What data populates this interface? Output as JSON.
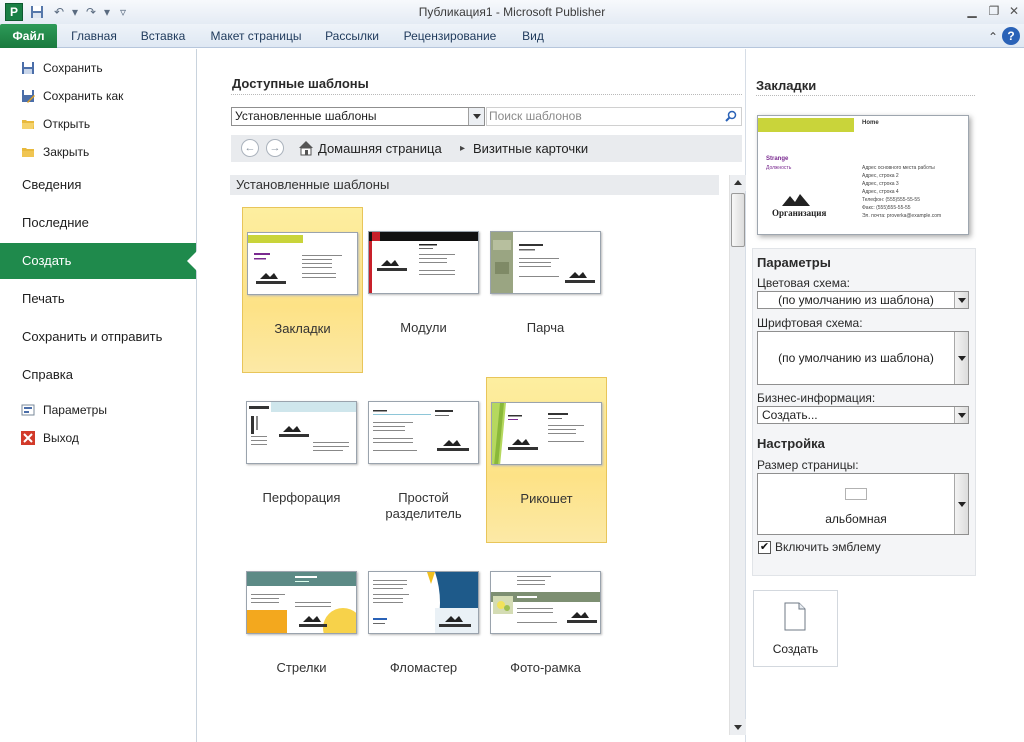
{
  "window": {
    "title": "Публикация1  -  Microsoft Publisher",
    "app_icon": "P"
  },
  "quick_access": {
    "save_icon": "floppy-icon",
    "undo_icon": "undo-icon",
    "redo_icon": "redo-icon"
  },
  "ribbon": {
    "tabs": [
      {
        "label": "Файл"
      },
      {
        "label": "Главная"
      },
      {
        "label": "Вставка"
      },
      {
        "label": "Макет страницы"
      },
      {
        "label": "Рассылки"
      },
      {
        "label": "Рецензирование"
      },
      {
        "label": "Вид"
      }
    ],
    "help": "?"
  },
  "leftnav": {
    "commands_top": [
      {
        "label": "Сохранить"
      },
      {
        "label": "Сохранить как"
      },
      {
        "label": "Открыть"
      },
      {
        "label": "Закрыть"
      }
    ],
    "sections": [
      {
        "label": "Сведения"
      },
      {
        "label": "Последние"
      },
      {
        "label": "Создать"
      },
      {
        "label": "Печать"
      },
      {
        "label": "Сохранить и отправить"
      },
      {
        "label": "Справка"
      }
    ],
    "commands_bottom": [
      {
        "label": "Параметры"
      },
      {
        "label": "Выход"
      }
    ],
    "active_color": "#1f8a4c"
  },
  "center": {
    "title": "Доступные шаблоны",
    "dropdown_value": "Установленные шаблоны",
    "search_placeholder": "Поиск шаблонов",
    "breadcrumb": {
      "home": "Домашняя страница",
      "separator": "▸",
      "current": "Визитные карточки"
    },
    "section_header": "Установленные шаблоны",
    "templates": [
      {
        "label": "Закладки",
        "selected": true
      },
      {
        "label": "Модули",
        "selected": false
      },
      {
        "label": "Парча",
        "selected": false
      },
      {
        "label": "Перфорация",
        "selected": false
      },
      {
        "label": "Простой разделитель",
        "selected": false
      },
      {
        "label": "Рикошет",
        "selected": true
      },
      {
        "label": "Стрелки",
        "selected": false
      },
      {
        "label": "Фломастер",
        "selected": false
      },
      {
        "label": "Фото-рамка",
        "selected": false
      }
    ]
  },
  "card_preview": {
    "name": "Strange",
    "position": "Должность",
    "org": "Организация",
    "home": "Home",
    "address_lines": [
      "Адрес основного места работы",
      "Адрес, строка 2",
      "Адрес, строка 3",
      "Адрес, строка 4"
    ],
    "phone": "Телефон: (555)555-55-55",
    "fax": "Факс: (555)555-55-55",
    "email": "Эл. почта: proverka@example.com"
  },
  "right": {
    "title": "Закладки",
    "params_header": "Параметры",
    "color_scheme_label": "Цветовая схема:",
    "color_scheme_value": "(по умолчанию из шаблона)",
    "font_scheme_label": "Шрифтовая схема:",
    "font_scheme_value": "(по умолчанию из шаблона)",
    "business_info_label": "Бизнес-информация:",
    "business_info_value": "Создать...",
    "settings_header": "Настройка",
    "page_size_label": "Размер страницы:",
    "page_size_value": "альбомная",
    "logo_checkbox_label": "Включить эмблему",
    "logo_checked": true,
    "create_button": "Создать"
  }
}
